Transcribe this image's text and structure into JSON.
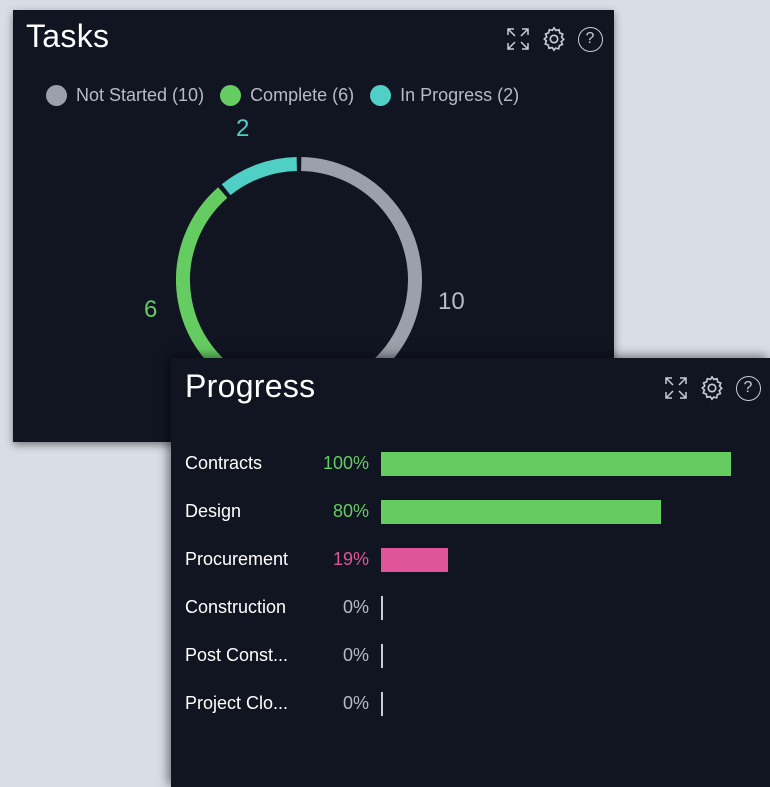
{
  "tasks": {
    "title": "Tasks",
    "legend": [
      {
        "label": "Not Started (10)",
        "color": "#9ba0aa"
      },
      {
        "label": "Complete (6)",
        "color": "#65cc62"
      },
      {
        "label": "In Progress (2)",
        "color": "#4fcfc6"
      }
    ],
    "donut": {
      "segments": [
        {
          "name": "Not Started",
          "value": 10,
          "label": "10",
          "color": "#9ba0aa"
        },
        {
          "name": "Complete",
          "value": 6,
          "label": "6",
          "color": "#65cc62"
        },
        {
          "name": "In Progress",
          "value": 2,
          "label": "2",
          "color": "#4fcfc6"
        }
      ]
    },
    "tools": {
      "expand_icon": "expand-icon",
      "settings_icon": "gear-icon",
      "help_label": "?"
    }
  },
  "progress": {
    "title": "Progress",
    "rows": [
      {
        "name": "Contracts",
        "pct_label": "100%",
        "value": 100,
        "color": "#65cc62"
      },
      {
        "name": "Design",
        "pct_label": "80%",
        "value": 80,
        "color": "#65cc62"
      },
      {
        "name": "Procurement",
        "pct_label": "19%",
        "value": 19,
        "color": "#e0559a"
      },
      {
        "name": "Construction",
        "pct_label": "0%",
        "value": 0,
        "color": "#c9ccd4"
      },
      {
        "name": "Post Const...",
        "pct_label": "0%",
        "value": 0,
        "color": "#c9ccd4"
      },
      {
        "name": "Project Clo...",
        "pct_label": "0%",
        "value": 0,
        "color": "#c9ccd4"
      }
    ],
    "tools": {
      "expand_icon": "expand-icon",
      "settings_icon": "gear-icon",
      "help_label": "?"
    }
  }
}
